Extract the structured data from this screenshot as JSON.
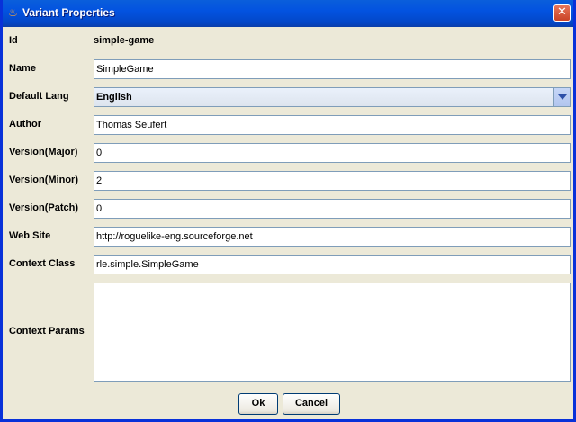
{
  "window": {
    "title": "Variant Properties",
    "close_glyph": "✕",
    "app_icon": "coffee-cup-icon",
    "app_icon_glyph": "♨"
  },
  "form": {
    "id": {
      "label": "Id",
      "value": "simple-game"
    },
    "name": {
      "label": "Name",
      "value": "SimpleGame"
    },
    "default_lang": {
      "label": "Default Lang",
      "selected": "English"
    },
    "author": {
      "label": "Author",
      "value": "Thomas Seufert"
    },
    "version_major": {
      "label": "Version(Major)",
      "value": "0"
    },
    "version_minor": {
      "label": "Version(Minor)",
      "value": "2"
    },
    "version_patch": {
      "label": "Version(Patch)",
      "value": "0"
    },
    "web_site": {
      "label": "Web Site",
      "value": "http://roguelike-eng.sourceforge.net"
    },
    "context_class": {
      "label": "Context Class",
      "value": "rle.simple.SimpleGame"
    },
    "context_params": {
      "label": "Context Params",
      "value": ""
    }
  },
  "buttons": {
    "ok": "Ok",
    "cancel": "Cancel"
  },
  "colors": {
    "titlebar": "#0353e0",
    "background": "#ece9d8",
    "field_border": "#7f9db9",
    "close": "#c94226"
  }
}
